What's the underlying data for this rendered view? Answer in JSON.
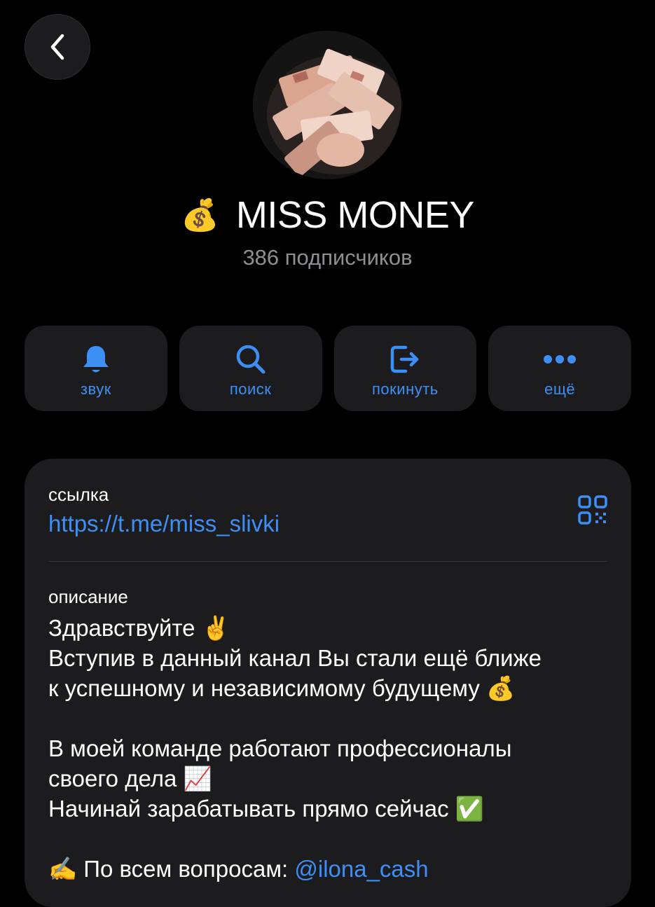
{
  "header": {
    "title": "MISS MONEY",
    "title_emoji": "💰",
    "subscribers": "386 подписчиков"
  },
  "icons": {
    "back": "chevron-left-icon",
    "bell": "bell-icon",
    "search": "search-icon",
    "leave": "leave-icon",
    "more": "more-icon",
    "qr": "qr-code-icon"
  },
  "actions": {
    "sound": "звук",
    "search": "поиск",
    "leave": "покинуть",
    "more": "ещё"
  },
  "info": {
    "link_label": "ссылка",
    "link_url": "https://t.me/miss_slivki",
    "description_label": "описание",
    "lines": {
      "l1": "Здравствуйте",
      "l1_emoji": "✌️",
      "l2": "Вступив в данный канал Вы стали ещё ближе",
      "l3": "к успешному и независимому будущему",
      "l3_emoji": "💰",
      "l4": "В моей команде работают профессионалы",
      "l5": "своего дела",
      "l5_emoji": "📈",
      "l6": "Начинай зарабатывать прямо сейчас",
      "l6_emoji": "✅",
      "l7_emoji": "✍️",
      "l7": "По всем вопросам:",
      "mention": "@ilona_cash"
    }
  },
  "colors": {
    "accent": "#3e8ff5",
    "background": "#000000",
    "card": "#1c1c1e",
    "secondary_text": "#8e8e93"
  }
}
